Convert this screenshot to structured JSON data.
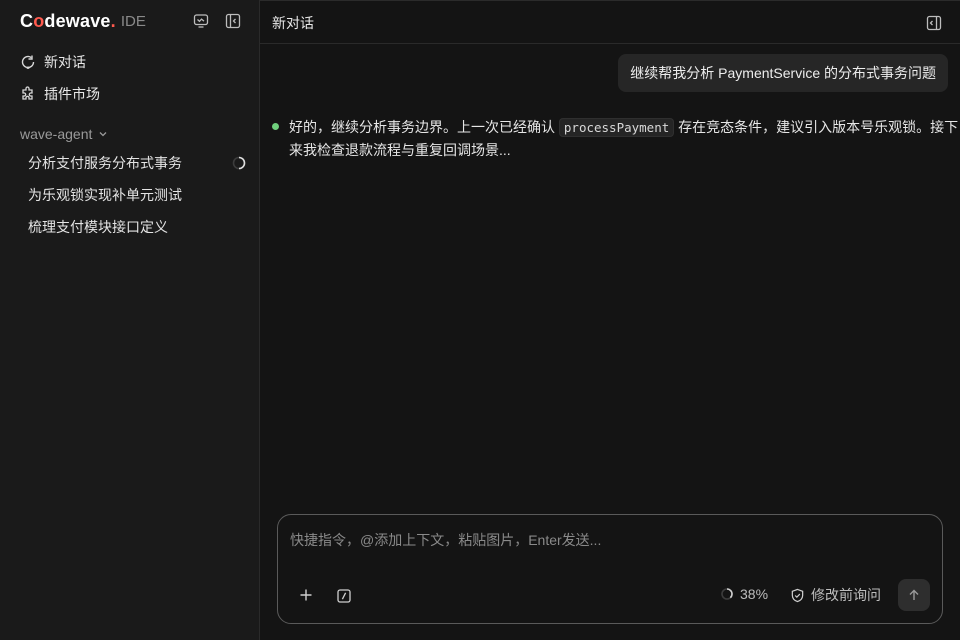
{
  "brand": {
    "logo_c": "C",
    "logo_o": "o",
    "logo_rest": "dewave",
    "logo_dot": ".",
    "suffix": "IDE"
  },
  "sidebar": {
    "nav": [
      {
        "label": "新对话",
        "icon": "new-chat-icon"
      },
      {
        "label": "插件市场",
        "icon": "puzzle-icon"
      }
    ],
    "group": {
      "label": "wave-agent",
      "icon": "chevron-down-icon"
    },
    "sessions": [
      {
        "title": "分析支付服务分布式事务",
        "status": "loading"
      },
      {
        "title": "为乐观锁实现补单元测试",
        "status": ""
      },
      {
        "title": "梳理支付模块接口定义",
        "status": ""
      }
    ]
  },
  "header": {
    "title": "新对话"
  },
  "conversation": {
    "user_message": "继续帮我分析 PaymentService 的分布式事务问题",
    "assistant_before_code": "好的，继续分析事务边界。上一次已经确认 ",
    "assistant_code": "processPayment",
    "assistant_after_code": " 存在竞态条件，建议引入版本号乐观锁。接下来我检查退款流程与重复回调场景..."
  },
  "composer": {
    "placeholder": "快捷指令，@添加上下文，粘贴图片，Enter发送...",
    "progress_label": "38%",
    "progress_value": 0.38,
    "mode_label": "修改前询问"
  },
  "colors": {
    "accent": "#ff5a4e",
    "status_green": "#6fcf7c",
    "background": "#141414",
    "sidebar": "#1a1a1a"
  }
}
